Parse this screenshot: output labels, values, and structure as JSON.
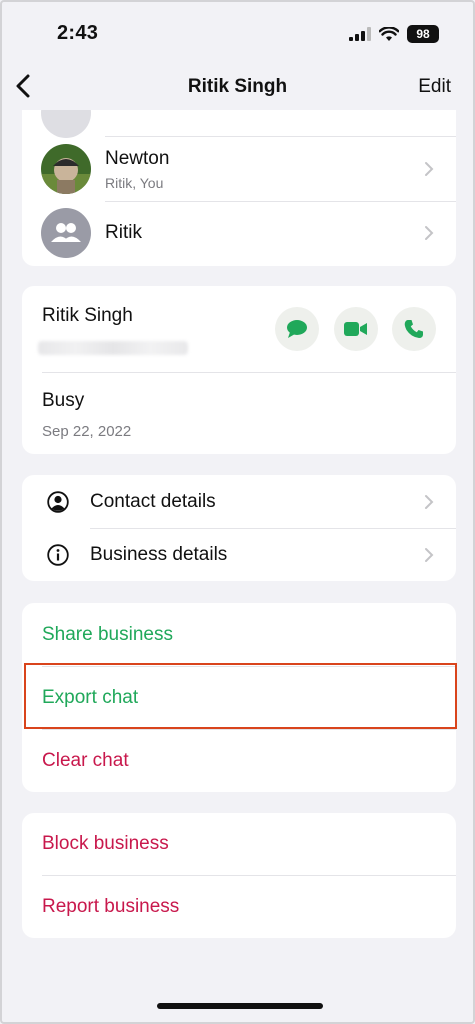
{
  "status_bar": {
    "time": "2:43",
    "battery": "98"
  },
  "nav": {
    "title": "Ritik Singh",
    "edit": "Edit"
  },
  "groups": [
    {
      "name": "Newton",
      "subtitle": "Ritik, You"
    },
    {
      "name": "Ritik"
    }
  ],
  "contact": {
    "name": "Ritik Singh",
    "about": "Busy",
    "about_date": "Sep 22, 2022"
  },
  "details": {
    "contact_details": "Contact details",
    "business_details": "Business details"
  },
  "actions": {
    "share": "Share business",
    "export": "Export chat",
    "clear": "Clear chat"
  },
  "danger": {
    "block": "Block business",
    "report": "Report business"
  },
  "colors": {
    "accent_green": "#20a85a",
    "destructive": "#c8184c",
    "highlight": "#d9441c"
  }
}
